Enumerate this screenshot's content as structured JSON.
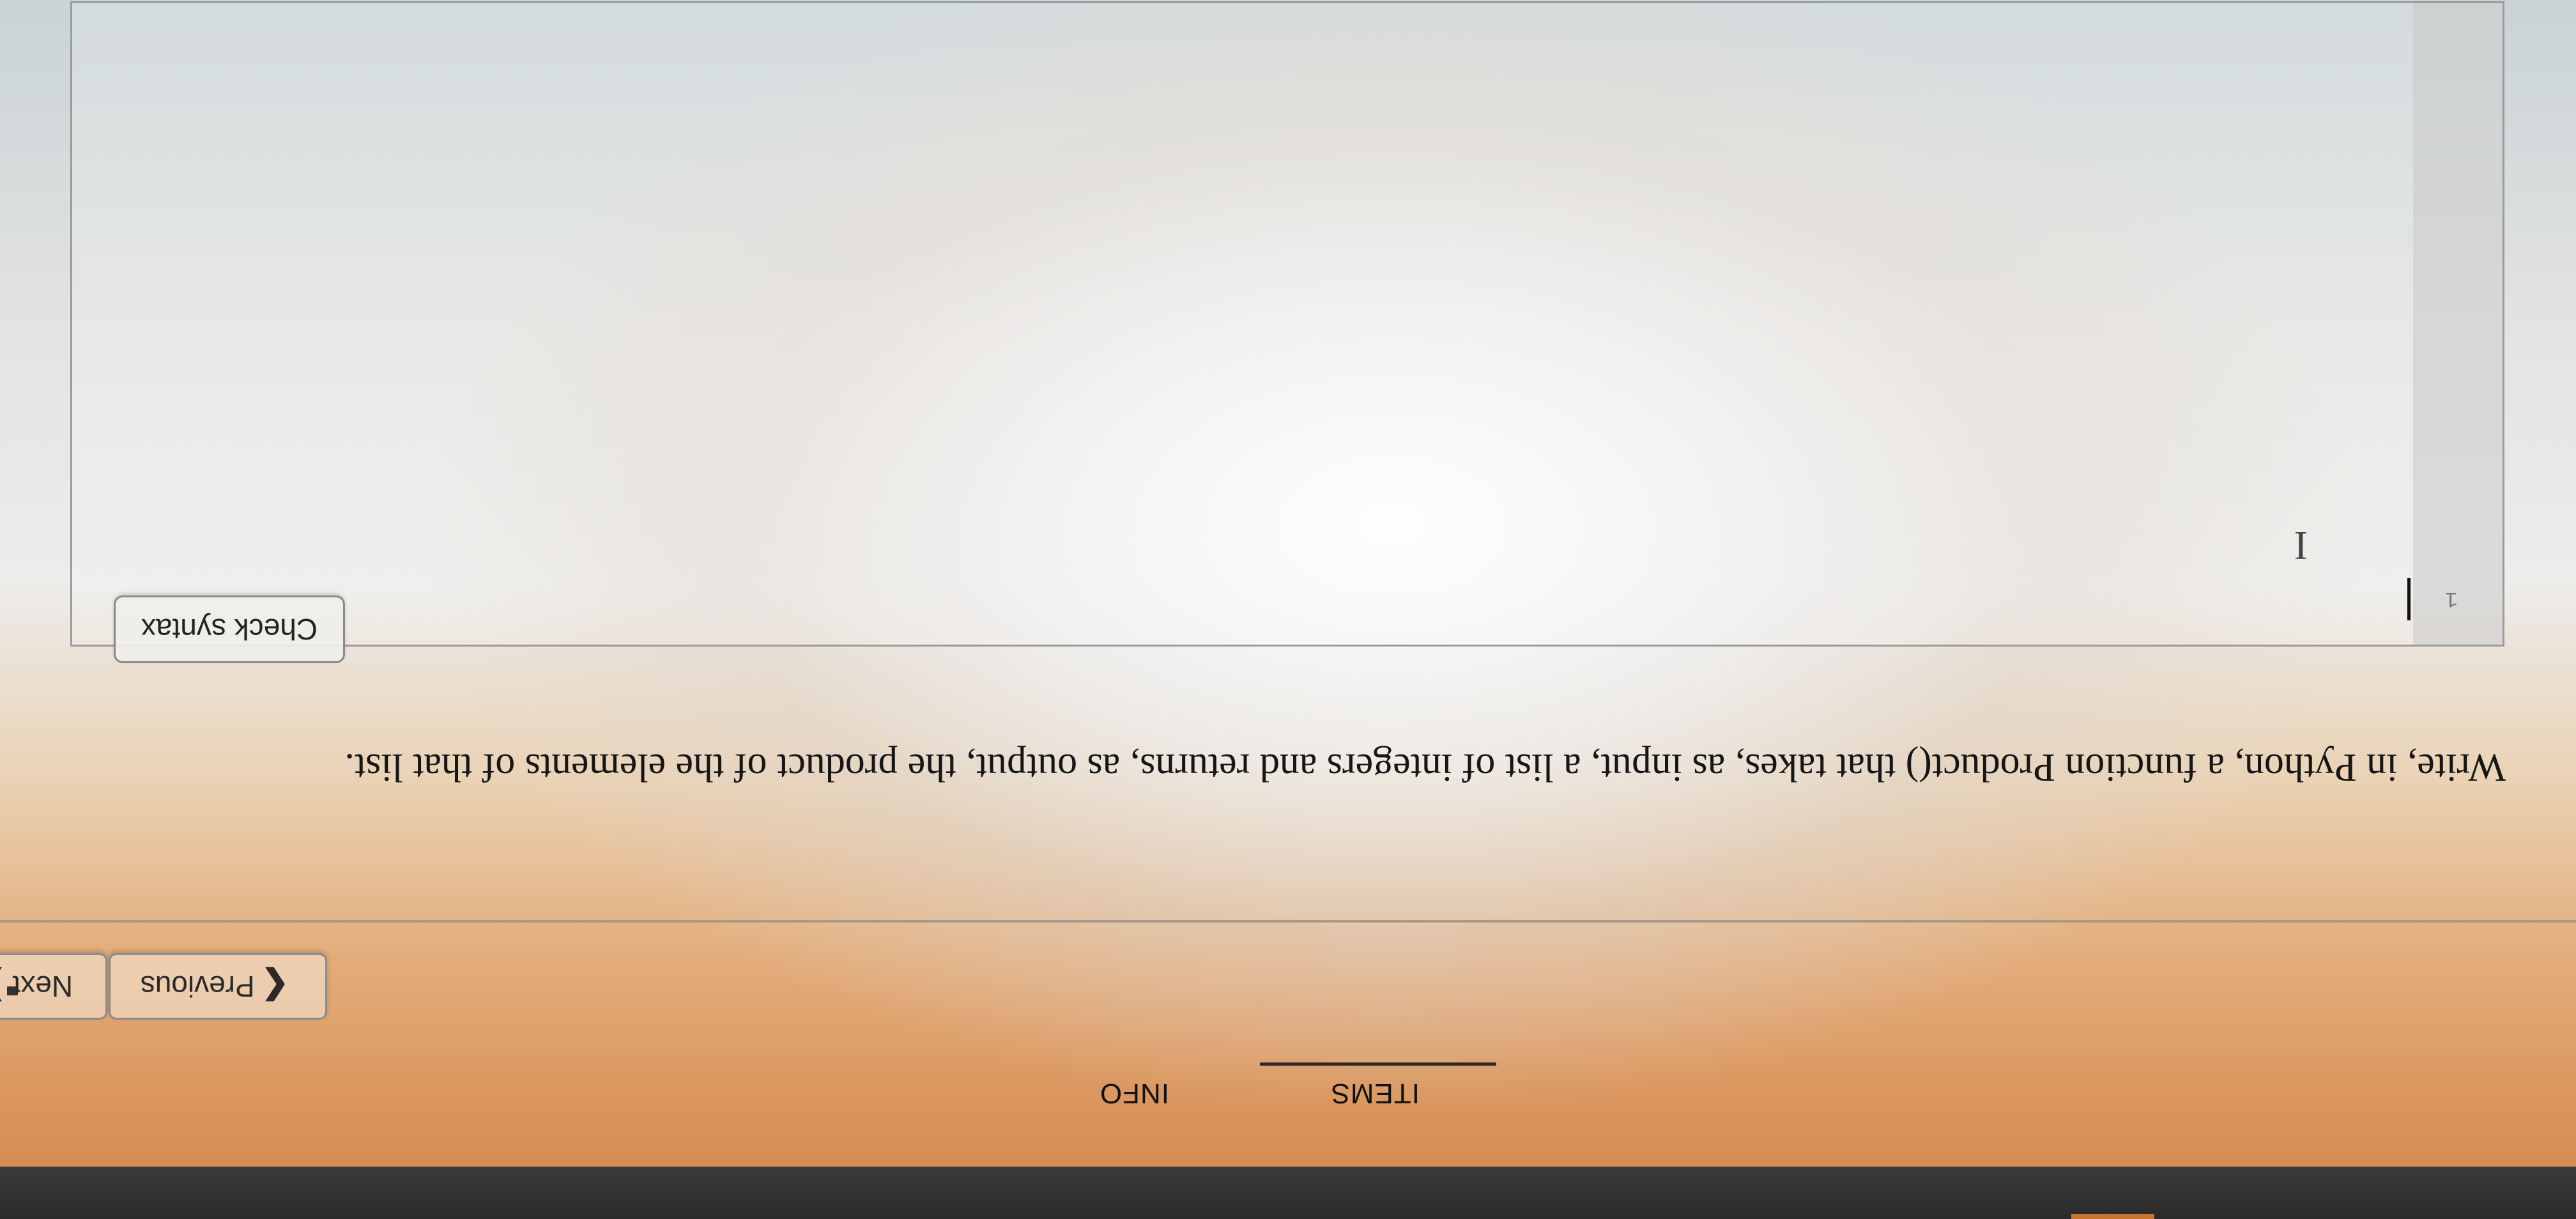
{
  "tabs": [
    {
      "label": "INFO",
      "active": false
    },
    {
      "label": "ITEMS",
      "active": true
    }
  ],
  "navigation": {
    "previous_label": "Previous",
    "next_label": "Next",
    "previous_chevron": "❮",
    "next_chevron": "❯"
  },
  "question": {
    "text": "Write, in Python, a function Product() that takes, as input, a list of integers and returns, as output, the product of the elements of that list."
  },
  "editor": {
    "check_syntax_label": "Check syntax",
    "line_number": "1",
    "cursor_glyph": "I",
    "content": ""
  },
  "colors": {
    "accent": "#c8742c"
  }
}
